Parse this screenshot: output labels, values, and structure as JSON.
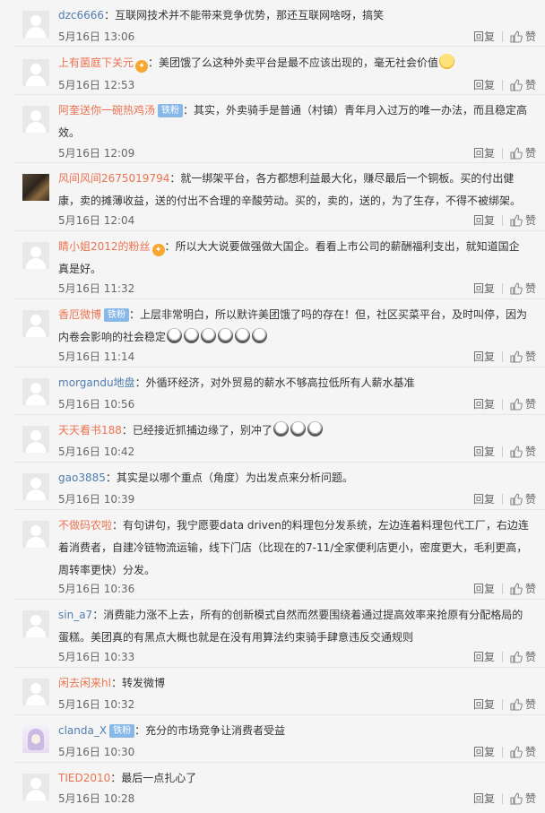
{
  "actions": {
    "reply": "回复",
    "like": "赞"
  },
  "comments": [
    {
      "user": "dzc6666",
      "sep": "：",
      "text": "互联网技术并不能带来竞争优势，那还互联网啥呀，搞笑",
      "time": "5月16日 13:06"
    },
    {
      "user": "上有菌庭下关元",
      "sep": "：",
      "text": "美团饿了么这种外卖平台是最不应该出现的，毫无社会价值",
      "time": "5月16日 12:53"
    },
    {
      "user": "阿奎送你一碗热鸡汤",
      "badge": "铁粉",
      "sep": "：",
      "text": "其实，外卖骑手是普通（村镇）青年月入过万的唯一办法，而且稳定高效。",
      "time": "5月16日 12:09"
    },
    {
      "user": "风间风间2675019794",
      "sep": "：",
      "text": "就一绑架平台，各方都想利益最大化，赚尽最后一个铜板。买的付出健康，卖的摊薄收益，送的付出不合理的辛酸劳动。买的，卖的，送的，为了生存，不得不被绑架。",
      "time": "5月16日 12:04"
    },
    {
      "user": "睛小姐2012的粉丝",
      "sep": "：",
      "text": "所以大大说要做强做大国企。看看上市公司的薪酬福利支出，就知道国企真是好。",
      "time": "5月16日 11:32"
    },
    {
      "user": "香厄微博",
      "badge": "铁粉",
      "sep": "：",
      "text": "上层非常明白，所以默许美团饿了吗的存在！但，社区买菜平台，及时叫停，因为内卷会影响的社会稳定",
      "time": "5月16日 11:14"
    },
    {
      "user": "morgandu地盘",
      "sep": "：",
      "text": "外循环经济，对外贸易的薪水不够高拉低所有人薪水基准",
      "time": "5月16日 10:56"
    },
    {
      "user": "天天看书188",
      "sep": "：",
      "text": "已经接近抓捕边缘了，别冲了",
      "time": "5月16日 10:42"
    },
    {
      "user": "gao3885",
      "sep": "：",
      "text": "其实是以哪个重点（角度）为出发点来分析问题。",
      "time": "5月16日 10:39"
    },
    {
      "user": "不做码农啦",
      "sep": "：",
      "text": "有句讲句，我宁愿要data driven的料理包分发系统，左边连着料理包代工厂，右边连着消费者，自建冷链物流运输，线下门店（比现在的7-11/全家便利店更小，密度更大，毛利更高，周转率更快）分发。",
      "time": "5月16日 10:36"
    },
    {
      "user": "sin_a7",
      "sep": "：",
      "text": "消费能力涨不上去，所有的创新模式自然而然要围绕着通过提高效率来抢原有分配格局的蛋糕。美团真的有黑点大概也就是在没有用算法约束骑手肆意违反交通规则",
      "time": "5月16日 10:33"
    },
    {
      "user": "闲去闲来hl",
      "sep": "：",
      "text": "转发微博",
      "time": "5月16日 10:32"
    },
    {
      "user": "clanda_X",
      "badge": "铁粉",
      "sep": "：",
      "text": "充分的市场竞争让消费者受益",
      "time": "5月16日 10:30"
    },
    {
      "user": "TIED2010",
      "sep": "：",
      "text": "最后一点扎心了",
      "time": "5月16日 10:28"
    }
  ]
}
